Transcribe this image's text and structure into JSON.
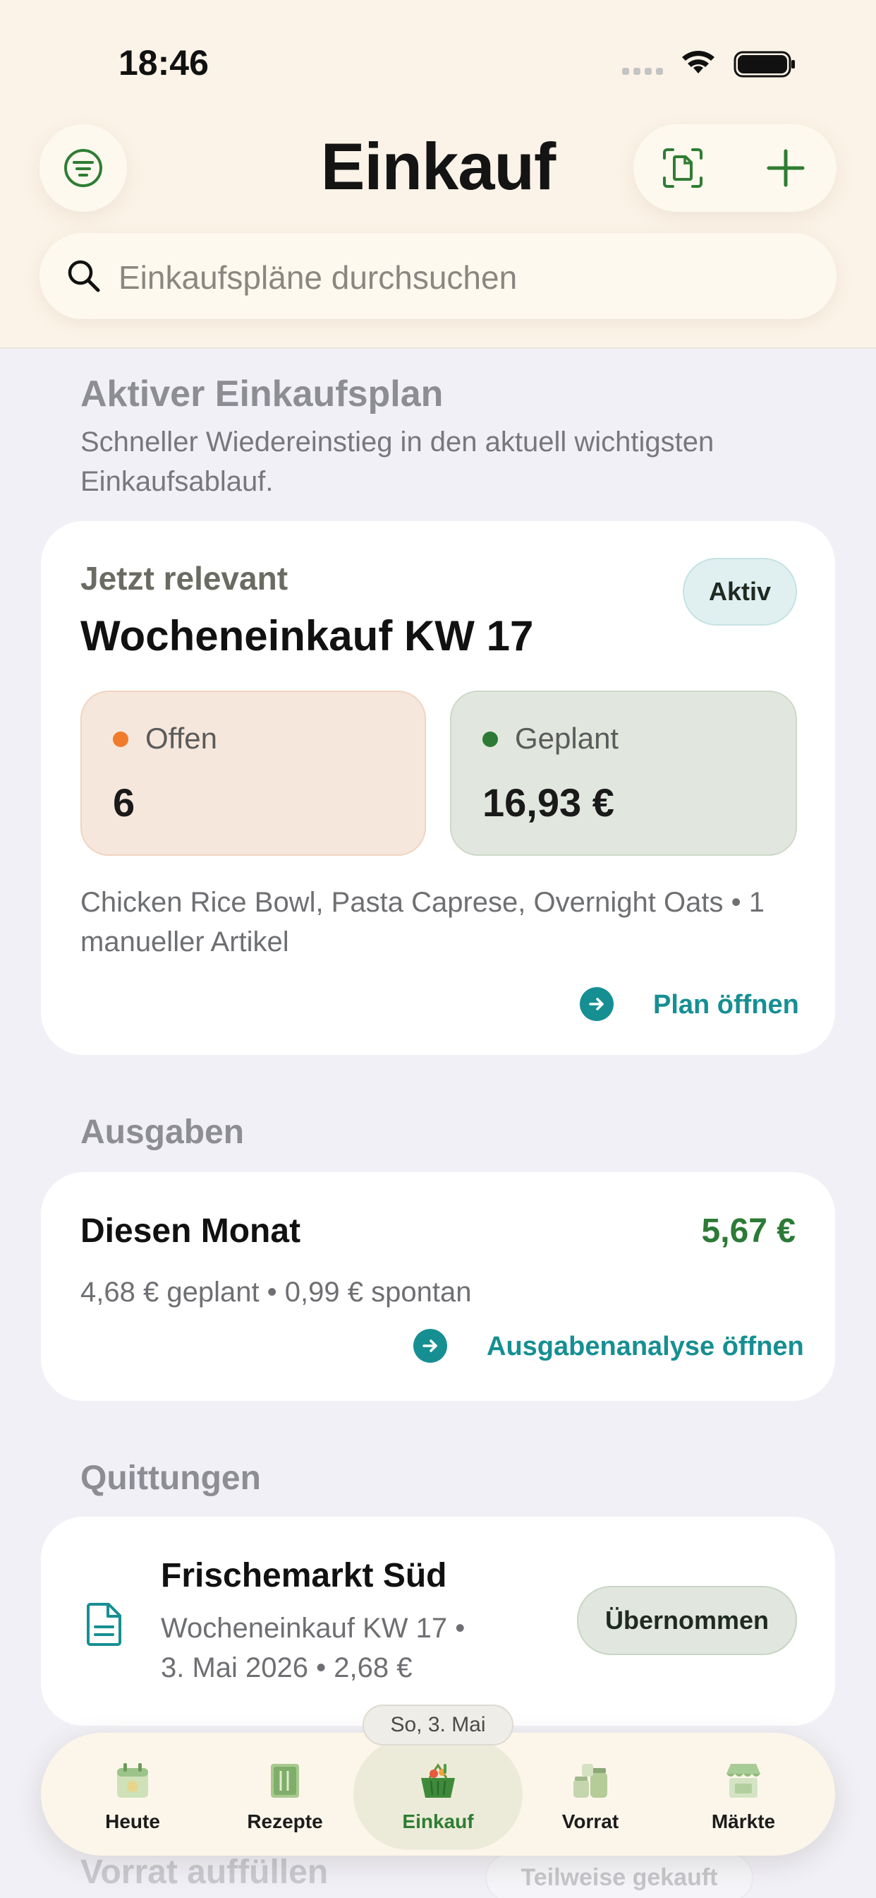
{
  "status_bar": {
    "time": "18:46"
  },
  "header": {
    "title": "Einkauf",
    "search_placeholder": "Einkaufspläne durchsuchen"
  },
  "active_plan_section": {
    "title": "Aktiver Einkaufsplan",
    "subtitle": "Schneller Wiedereinstieg in den aktuell wichtigsten Einkaufsablauf."
  },
  "active_plan_card": {
    "kicker": "Jetzt relevant",
    "title": "Wocheneinkauf KW 17",
    "badge": "Aktiv",
    "stats": [
      {
        "label": "Offen",
        "value": "6",
        "dot_color": "#f07b2a"
      },
      {
        "label": "Geplant",
        "value": "16,93 €",
        "dot_color": "#2c7a36"
      }
    ],
    "description": "Chicken Rice Bowl, Pasta Caprese, Overnight Oats • 1 manueller Artikel",
    "action_label": "Plan öffnen"
  },
  "spending_section": {
    "title": "Ausgaben"
  },
  "spending_card": {
    "title": "Diesen Monat",
    "amount": "5,67 €",
    "detail": "4,68 € geplant • 0,99 € spontan",
    "action_label": "Ausgabenanalyse öffnen"
  },
  "receipts_section": {
    "title": "Quittungen"
  },
  "receipt_card": {
    "store": "Frischemarkt Süd",
    "detail_line1": "Wocheneinkauf KW 17 •",
    "detail_line2": "3. Mai 2026 • 2,68 €",
    "status": "Übernommen"
  },
  "next_section": {
    "title": "Vorrat auffüllen",
    "chip": "Teilweise gekauft"
  },
  "date_chip": "So, 3. Mai",
  "tabs": [
    {
      "label": "Heute",
      "icon": "calendar-icon"
    },
    {
      "label": "Rezepte",
      "icon": "recipe-book-icon"
    },
    {
      "label": "Einkauf",
      "icon": "basket-icon",
      "active": true
    },
    {
      "label": "Vorrat",
      "icon": "jars-icon"
    },
    {
      "label": "Märkte",
      "icon": "market-stall-icon"
    }
  ],
  "colors": {
    "header_bg": "#fcf3e8",
    "accent_green": "#2c7a36",
    "accent_teal": "#168f93",
    "badge_bg": "#e0f0f0"
  }
}
